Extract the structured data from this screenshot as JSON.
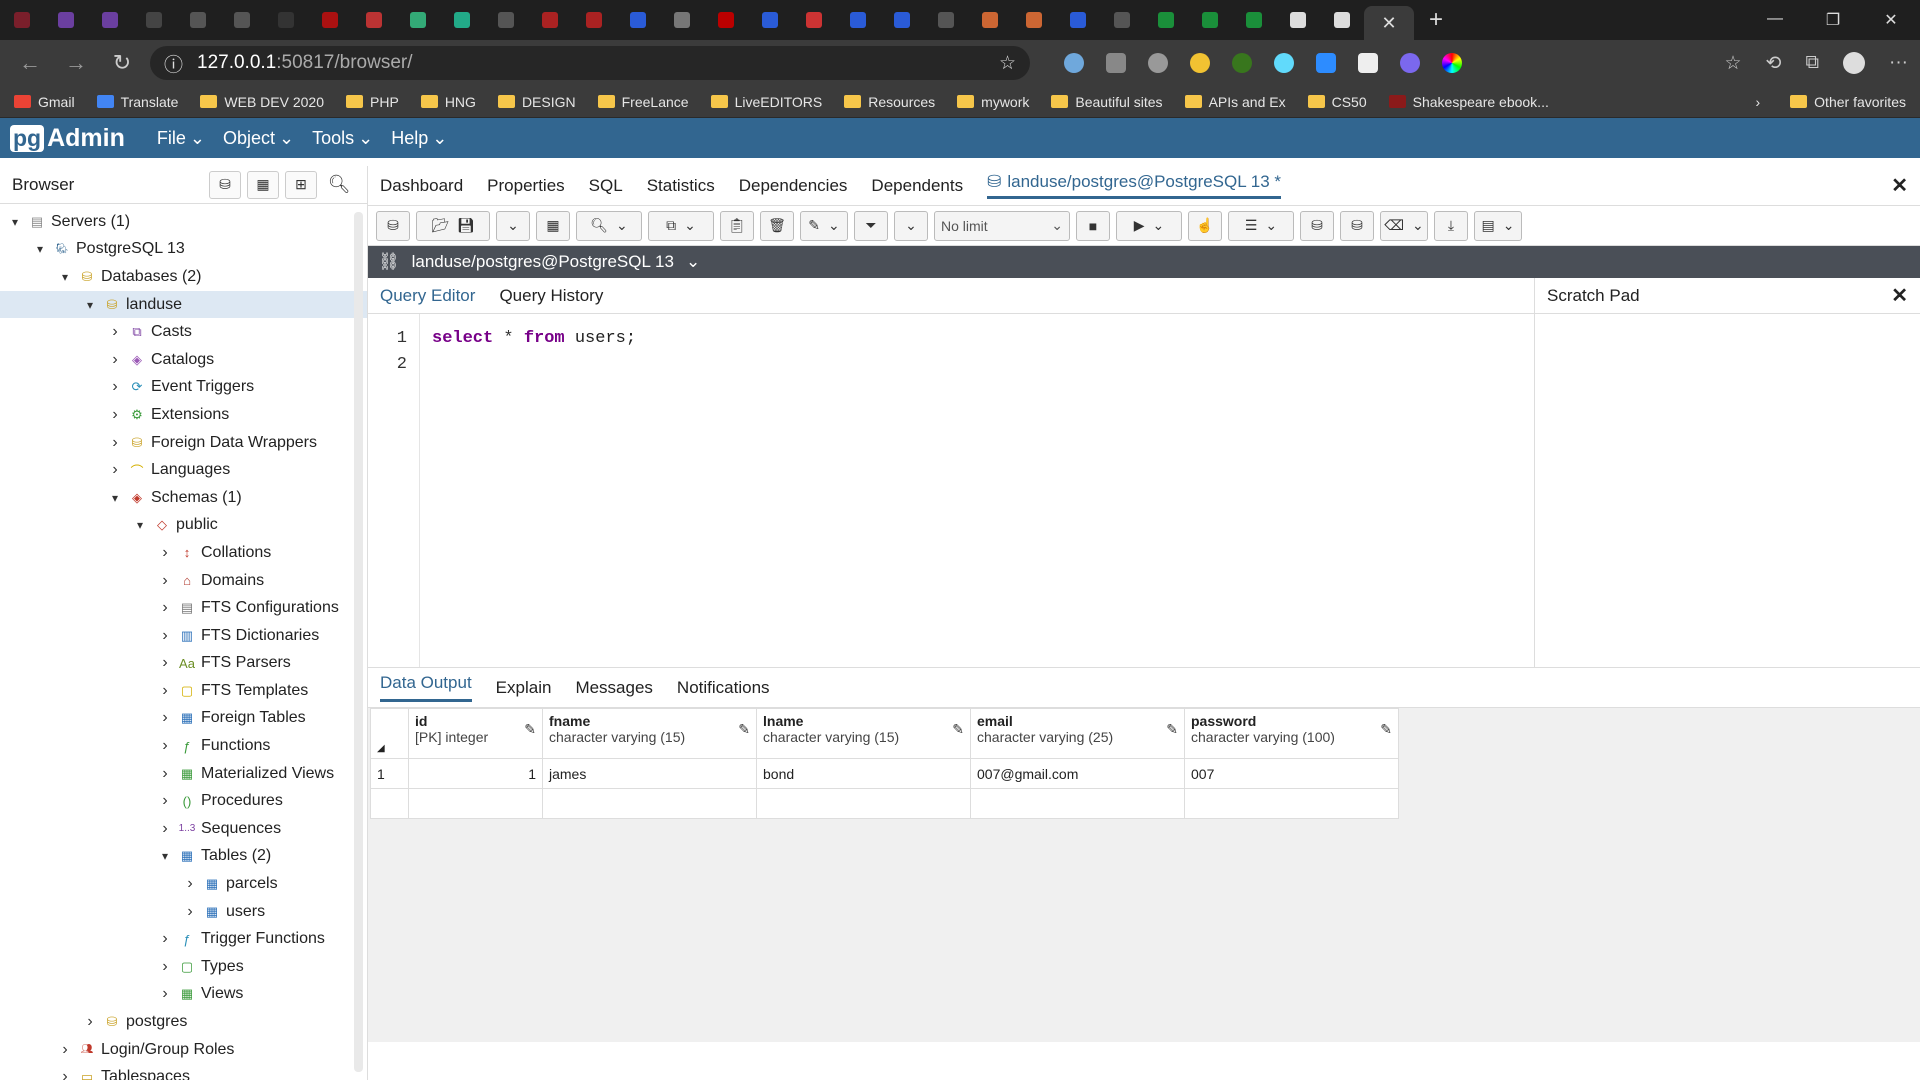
{
  "browser_chrome": {
    "url_host": "127.0.0.1",
    "url_path": ":50817/browser/",
    "bookmarks": [
      "Gmail",
      "Translate",
      "WEB DEV 2020",
      "PHP",
      "HNG",
      "DESIGN",
      "FreeLance",
      "LiveEDITORS",
      "Resources",
      "mywork",
      "Beautiful sites",
      "APIs and Ex",
      "CS50",
      "Shakespeare ebook..."
    ],
    "other_favorites": "Other favorites"
  },
  "app": {
    "logo_pg": "pg",
    "logo_rest": "Admin",
    "menus": [
      "File",
      "Object",
      "Tools",
      "Help"
    ]
  },
  "browser_panel": {
    "title": "Browser",
    "tree": [
      {
        "label": "Servers (1)",
        "depth": 0,
        "state": "open"
      },
      {
        "label": "PostgreSQL 13",
        "depth": 1,
        "state": "open"
      },
      {
        "label": "Databases (2)",
        "depth": 2,
        "state": "open"
      },
      {
        "label": "landuse",
        "depth": 3,
        "state": "open",
        "selected": true
      },
      {
        "label": "Casts",
        "depth": 4,
        "state": "closed"
      },
      {
        "label": "Catalogs",
        "depth": 4,
        "state": "closed"
      },
      {
        "label": "Event Triggers",
        "depth": 4,
        "state": "closed"
      },
      {
        "label": "Extensions",
        "depth": 4,
        "state": "closed"
      },
      {
        "label": "Foreign Data Wrappers",
        "depth": 4,
        "state": "closed"
      },
      {
        "label": "Languages",
        "depth": 4,
        "state": "closed"
      },
      {
        "label": "Schemas (1)",
        "depth": 4,
        "state": "open"
      },
      {
        "label": "public",
        "depth": 5,
        "state": "open"
      },
      {
        "label": "Collations",
        "depth": 6,
        "state": "closed"
      },
      {
        "label": "Domains",
        "depth": 6,
        "state": "closed"
      },
      {
        "label": "FTS Configurations",
        "depth": 6,
        "state": "closed"
      },
      {
        "label": "FTS Dictionaries",
        "depth": 6,
        "state": "closed"
      },
      {
        "label": "FTS Parsers",
        "depth": 6,
        "state": "closed"
      },
      {
        "label": "FTS Templates",
        "depth": 6,
        "state": "closed"
      },
      {
        "label": "Foreign Tables",
        "depth": 6,
        "state": "closed"
      },
      {
        "label": "Functions",
        "depth": 6,
        "state": "closed"
      },
      {
        "label": "Materialized Views",
        "depth": 6,
        "state": "closed"
      },
      {
        "label": "Procedures",
        "depth": 6,
        "state": "closed"
      },
      {
        "label": "Sequences",
        "depth": 6,
        "state": "closed"
      },
      {
        "label": "Tables (2)",
        "depth": 6,
        "state": "open"
      },
      {
        "label": "parcels",
        "depth": 7,
        "state": "closed"
      },
      {
        "label": "users",
        "depth": 7,
        "state": "closed"
      },
      {
        "label": "Trigger Functions",
        "depth": 6,
        "state": "closed"
      },
      {
        "label": "Types",
        "depth": 6,
        "state": "closed"
      },
      {
        "label": "Views",
        "depth": 6,
        "state": "closed"
      },
      {
        "label": "postgres",
        "depth": 3,
        "state": "closed"
      },
      {
        "label": "Login/Group Roles",
        "depth": 2,
        "state": "closed"
      },
      {
        "label": "Tablespaces",
        "depth": 2,
        "state": "closed"
      }
    ]
  },
  "main_tabs": [
    "Dashboard",
    "Properties",
    "SQL",
    "Statistics",
    "Dependencies",
    "Dependents"
  ],
  "active_tab": "landuse/postgres@PostgreSQL 13 *",
  "toolbar": {
    "limit_select": "No limit"
  },
  "connection": "landuse/postgres@PostgreSQL 13",
  "editor": {
    "tabs": [
      "Query Editor",
      "Query History"
    ],
    "lines": [
      "1",
      "2"
    ],
    "code_kw1": "select",
    "code_op": " * ",
    "code_kw2": "from",
    "code_rest": " users;"
  },
  "scratch_pad": "Scratch Pad",
  "results": {
    "tabs": [
      "Data Output",
      "Explain",
      "Messages",
      "Notifications"
    ],
    "columns": [
      {
        "name": "id",
        "type": "[PK] integer"
      },
      {
        "name": "fname",
        "type": "character varying (15)"
      },
      {
        "name": "lname",
        "type": "character varying (15)"
      },
      {
        "name": "email",
        "type": "character varying (25)"
      },
      {
        "name": "password",
        "type": "character varying (100)"
      }
    ],
    "rows": [
      {
        "num": "1",
        "cells": [
          "1",
          "james",
          "bond",
          "007@gmail.com",
          "007"
        ]
      }
    ]
  }
}
